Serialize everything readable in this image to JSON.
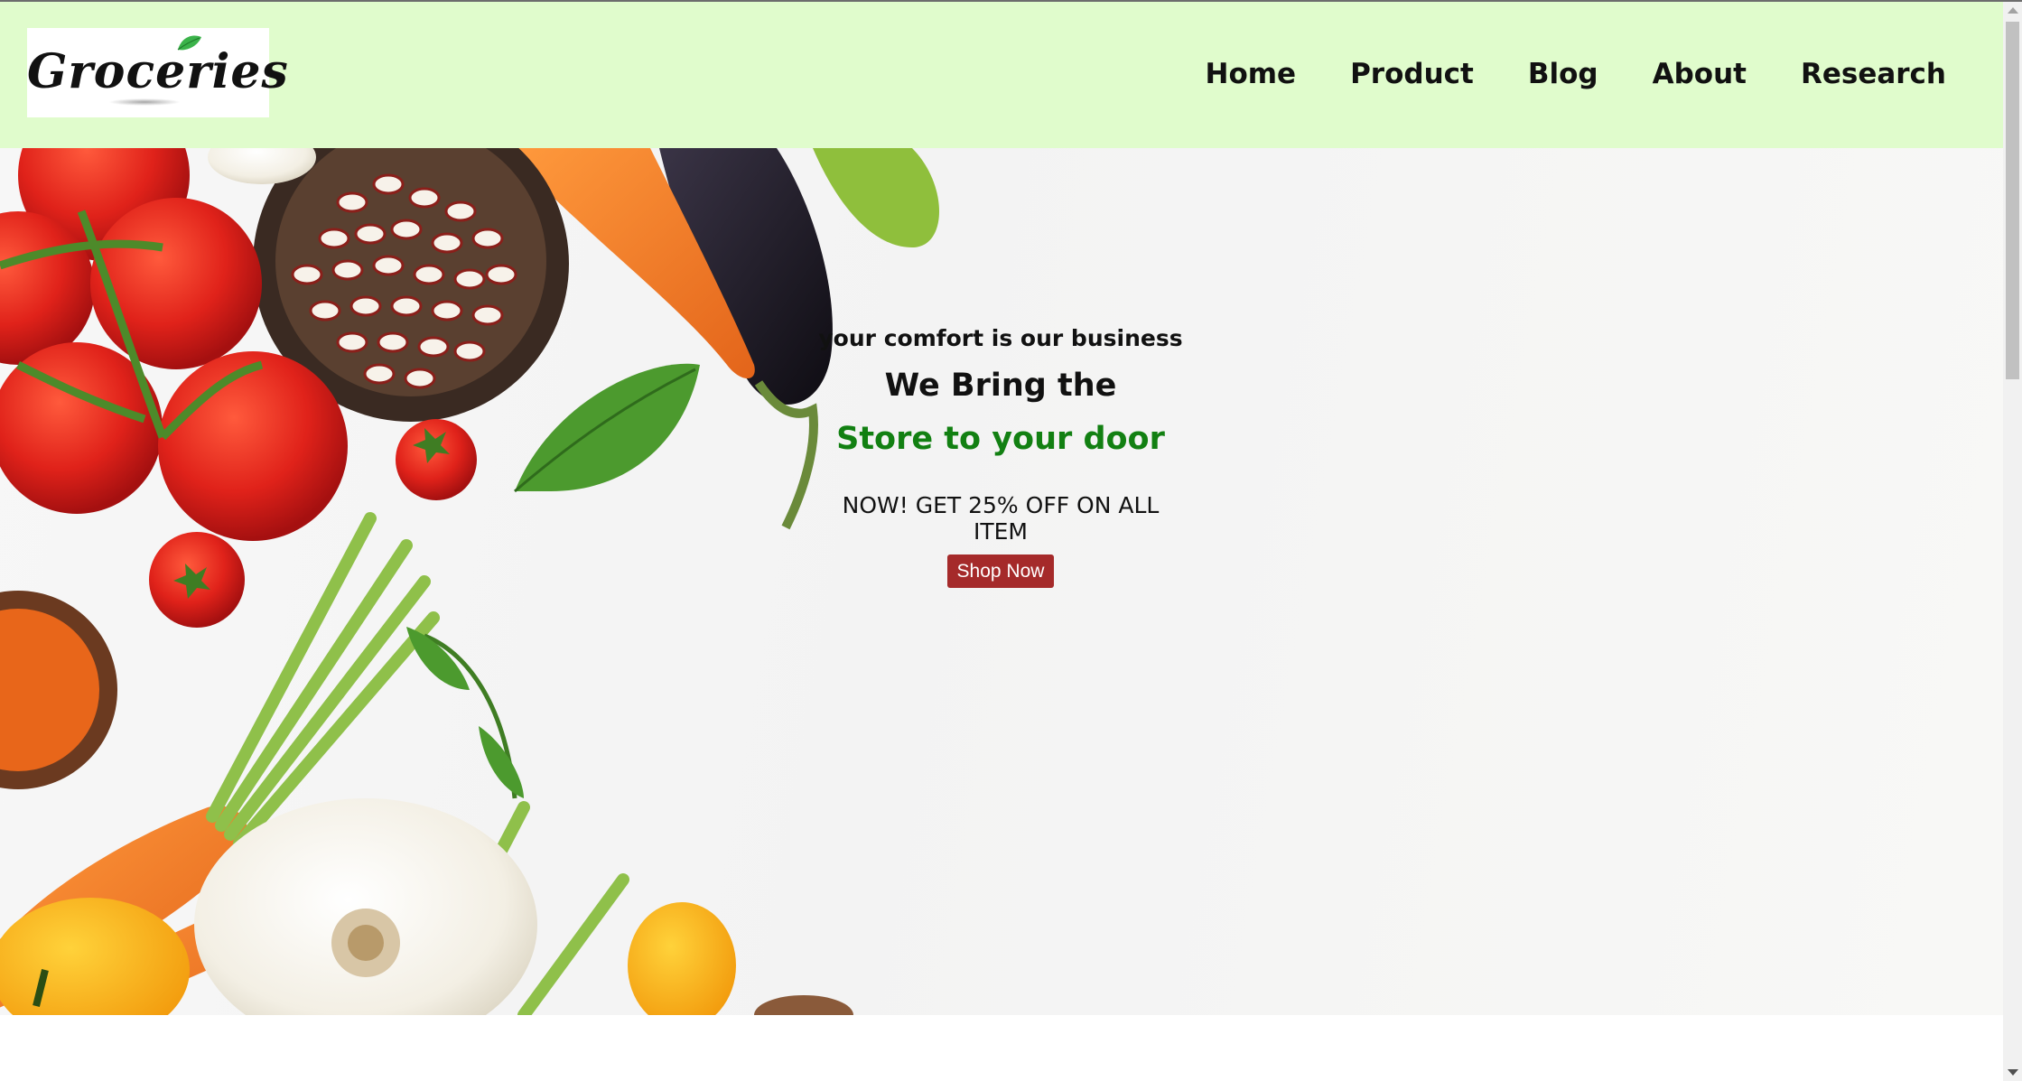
{
  "logo": {
    "text": "Groceries",
    "icon": "leaf-icon"
  },
  "nav": {
    "items": [
      {
        "label": "Home"
      },
      {
        "label": "Product"
      },
      {
        "label": "Blog"
      },
      {
        "label": "About"
      },
      {
        "label": "Research"
      }
    ]
  },
  "hero": {
    "tagline": "your comfort is our business",
    "headline_line1": "We Bring the",
    "headline_line2": "Store to your door",
    "offer": "NOW! GET 25% OFF ON ALL ITEM",
    "button_label": "Shop Now",
    "image": "vegetables-image"
  },
  "colors": {
    "navbar_bg": "#e0fccc",
    "accent_green": "#128012",
    "button_bg": "#a52a2a",
    "text": "#111111"
  },
  "scrollbar": {
    "icons": [
      "scroll-up-arrow-icon",
      "scroll-down-arrow-icon"
    ]
  }
}
